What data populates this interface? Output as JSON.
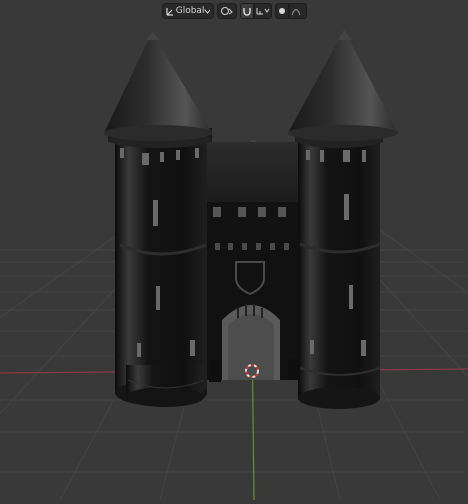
{
  "header": {
    "orientation_label": "Global",
    "orientation_icon": "transform-orientation-icon",
    "pivot_icon": "pivot-point-icon",
    "snap_icon": "magnet-snap-icon",
    "snap_target_icon": "snap-increment-icon",
    "proportional_edit_icon": "proportional-editing-icon",
    "falloff_icon": "falloff-curve-icon"
  },
  "viewport": {
    "background": "#393939",
    "grid_color": "#4a4a4a",
    "x_axis_color": "#8a3a44",
    "y_axis_color": "#6f8f2a",
    "object": "castle-gatehouse",
    "cursor_icon": "3d-cursor-icon"
  }
}
